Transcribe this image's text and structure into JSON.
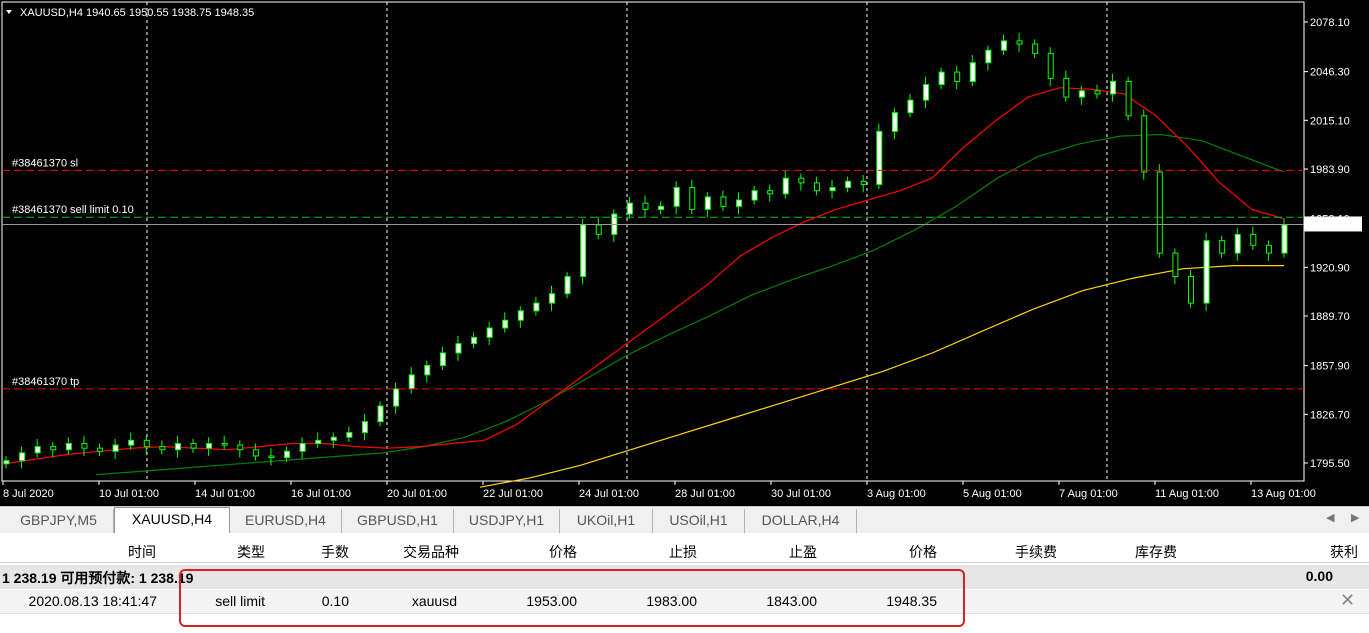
{
  "chart": {
    "symbol_info": "XAUUSD,H4  1940.65 1950.55 1938.75 1948.35",
    "price_labels": [
      "2078.10",
      "2046.30",
      "2015.10",
      "1983.90",
      "1920.90",
      "1889.70",
      "1857.90",
      "1826.70",
      "1795.50"
    ],
    "current_price": "1948.35",
    "partial_price": "1952.10",
    "date_labels": [
      "8 Jul 2020",
      "10 Jul 01:00",
      "14 Jul 01:00",
      "16 Jul 01:00",
      "20 Jul 01:00",
      "22 Jul 01:00",
      "24 Jul 01:00",
      "28 Jul 01:00",
      "30 Jul 01:00",
      "3 Aug 01:00",
      "5 Aug 01:00",
      "7 Aug 01:00",
      "11 Aug 01:00",
      "13 Aug 01:00"
    ],
    "order_lines": {
      "sl": "#38461370 sl",
      "sell_limit": "#38461370 sell limit 0.10",
      "tp": "#38461370 tp"
    },
    "colors": {
      "background": "#000000",
      "candle": "#00ff00",
      "bull_body": "#ffffff",
      "ma_fast": "#ff0000",
      "ma_mid": "#008000",
      "ma_slow": "#ffd700",
      "order_line": "#ff0000"
    }
  },
  "chart_data": {
    "type": "candlestick",
    "symbol": "XAUUSD",
    "timeframe": "H4",
    "ohlc_last": {
      "open": 1940.65,
      "high": 1950.55,
      "low": 1938.75,
      "close": 1948.35
    },
    "ylim": [
      1780,
      2090
    ],
    "y_ticks": [
      2078.1,
      2046.3,
      2015.1,
      1983.9,
      1920.9,
      1889.7,
      1857.9,
      1826.7,
      1795.5
    ],
    "x_tick_labels": [
      "8 Jul 2020",
      "10 Jul 01:00",
      "14 Jul 01:00",
      "16 Jul 01:00",
      "20 Jul 01:00",
      "22 Jul 01:00",
      "24 Jul 01:00",
      "28 Jul 01:00",
      "30 Jul 01:00",
      "3 Aug 01:00",
      "5 Aug 01:00",
      "7 Aug 01:00",
      "11 Aug 01:00",
      "13 Aug 01:00"
    ],
    "levels": {
      "sl": 1983,
      "sell_limit": 1953,
      "tp": 1843,
      "bid": 1948.35
    },
    "close_path": [
      1797,
      1802,
      1806,
      1804,
      1808,
      1805,
      1803,
      1807,
      1810,
      1806,
      1804,
      1808,
      1805,
      1808,
      1807,
      1804,
      1800,
      1799,
      1803,
      1808,
      1810,
      1812,
      1815,
      1822,
      1832,
      1843,
      1852,
      1858,
      1866,
      1872,
      1876,
      1882,
      1887,
      1893,
      1898,
      1904,
      1915,
      1948,
      1942,
      1955,
      1962,
      1958,
      1960,
      1972,
      1958,
      1966,
      1960,
      1964,
      1970,
      1968,
      1978,
      1975,
      1970,
      1972,
      1976,
      1974,
      2008,
      2020,
      2028,
      2038,
      2046,
      2040,
      2052,
      2060,
      2066,
      2064,
      2058,
      2042,
      2030,
      2034,
      2032,
      2040,
      2018,
      1982,
      1930,
      1915,
      1898,
      1938,
      1930,
      1942,
      1935,
      1930,
      1948
    ],
    "ma_fast_path": [
      1795,
      1798,
      1801,
      1803,
      1805,
      1806,
      1805,
      1804,
      1806,
      1808,
      1808,
      1806,
      1805,
      1806,
      1808,
      1810,
      1820,
      1835,
      1850,
      1865,
      1880,
      1895,
      1910,
      1928,
      1940,
      1950,
      1958,
      1964,
      1970,
      1978,
      1998,
      2015,
      2030,
      2036,
      2035,
      2032,
      2018,
      1998,
      1975,
      1958,
      1952
    ],
    "ma_mid_path": [
      1788,
      1790,
      1792,
      1794,
      1796,
      1798,
      1800,
      1802,
      1806,
      1812,
      1822,
      1835,
      1850,
      1865,
      1878,
      1890,
      1903,
      1913,
      1922,
      1932,
      1945,
      1960,
      1978,
      1992,
      2000,
      2005,
      2006,
      2002,
      1992,
      1982
    ],
    "ma_slow_path": [
      1780,
      1786,
      1794,
      1804,
      1814,
      1824,
      1834,
      1844,
      1854,
      1866,
      1880,
      1894,
      1906,
      1914,
      1920,
      1922,
      1922
    ]
  },
  "tabs": [
    {
      "label": "GBPJPY,M5"
    },
    {
      "label": "XAUUSD,H4"
    },
    {
      "label": "EURUSD,H4"
    },
    {
      "label": "GBPUSD,H1"
    },
    {
      "label": "USDJPY,H1"
    },
    {
      "label": "UKOil,H1"
    },
    {
      "label": "USOil,H1"
    },
    {
      "label": "DOLLAR,H4"
    }
  ],
  "terminal": {
    "headers": {
      "time": "时间",
      "type": "类型",
      "lots": "手数",
      "symbol": "交易品种",
      "price": "价格",
      "sl": "止损",
      "tp": "止盈",
      "cur_price": "价格",
      "commission": "手续费",
      "swap": "库存费",
      "profit": "获利"
    },
    "summary": {
      "text": "1 238.19  可用预付款: 1 238.19",
      "profit": "0.00"
    },
    "order": {
      "time": "2020.08.13 18:41:47",
      "type": "sell limit",
      "lots": "0.10",
      "symbol": "xauusd",
      "price": "1953.00",
      "sl": "1983.00",
      "tp": "1843.00",
      "cur_price": "1948.35"
    }
  }
}
